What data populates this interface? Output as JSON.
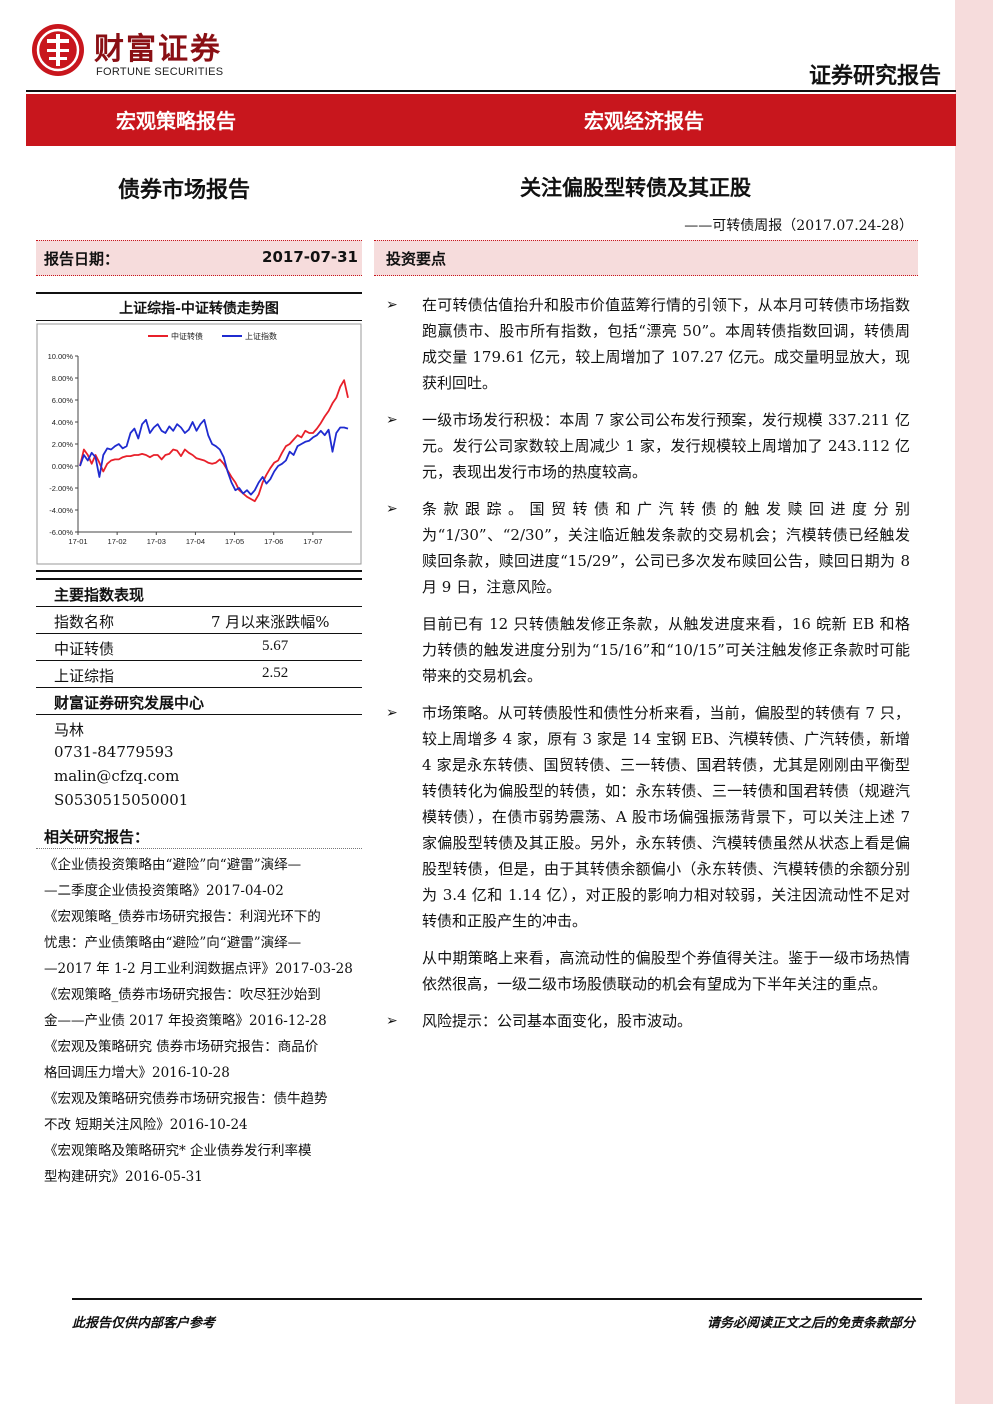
{
  "header": {
    "logo_cn": "财富证券",
    "logo_en": "FORTUNE SECURITIES",
    "doc_type": "证券研究报告"
  },
  "band": {
    "left": "宏观策略报告",
    "right": "宏观经济报告"
  },
  "titles": {
    "section": "债券市场报告",
    "main": "关注偏股型转债及其正股",
    "subtitle": "——可转债周报（2017.07.24-28）"
  },
  "report_date": {
    "label": "报告日期：",
    "value": "2017-07-31"
  },
  "investment_points_label": "投资要点",
  "chart_data": {
    "type": "line",
    "title": "上证综指-中证转债走势图",
    "legend": [
      "中证转债",
      "上证指数"
    ],
    "x_ticks": [
      "17-01",
      "17-02",
      "17-03",
      "17-04",
      "17-05",
      "17-06",
      "17-07"
    ],
    "y_ticks": [
      "10.00%",
      "8.00%",
      "6.00%",
      "4.00%",
      "2.00%",
      "0.00%",
      "-2.00%",
      "-4.00%",
      "-6.00%"
    ],
    "ylim": [
      -6,
      10
    ],
    "legend_position": "top",
    "colors": {
      "中证转债": "#e8202a",
      "上证指数": "#1f2bd0"
    },
    "series": [
      {
        "name": "中证转债",
        "values": [
          0.0,
          1.5,
          1.0,
          0.2,
          1.0,
          0.3,
          -0.5,
          0.2,
          0.5,
          0.6,
          0.6,
          0.8,
          0.9,
          0.9,
          1.0,
          1.0,
          1.1,
          1.0,
          0.8,
          1.0,
          1.0,
          0.6,
          1.0,
          1.1,
          1.5,
          1.4,
          0.9,
          1.5,
          1.2,
          1.0,
          0.7,
          0.6,
          0.5,
          0.3,
          0.2,
          0.3,
          0.6,
          0.2,
          -0.4,
          -1.0,
          -1.5,
          -2.2,
          -2.5,
          -2.8,
          -3.0,
          -3.2,
          -2.6,
          -1.5,
          -0.8,
          -0.2,
          0.3,
          0.5,
          1.2,
          1.8,
          2.0,
          2.4,
          2.8,
          2.6,
          3.2,
          3.0,
          3.0,
          3.4,
          3.9,
          4.5,
          5.0,
          5.7,
          6.2,
          7.2,
          7.8,
          6.2
        ]
      },
      {
        "name": "上证指数",
        "values": [
          0.0,
          1.0,
          0.5,
          1.2,
          0.8,
          -1.0,
          1.0,
          1.6,
          1.5,
          1.8,
          2.0,
          1.6,
          1.8,
          3.0,
          3.4,
          2.5,
          3.8,
          4.2,
          3.0,
          3.5,
          3.8,
          3.2,
          3.0,
          3.6,
          3.2,
          3.8,
          3.5,
          3.0,
          3.3,
          4.0,
          3.2,
          3.8,
          4.2,
          2.8,
          2.0,
          1.8,
          1.5,
          0.8,
          -0.5,
          -1.5,
          -2.2,
          -2.0,
          -2.5,
          -2.2,
          -2.6,
          -2.2,
          -1.5,
          -1.0,
          -1.6,
          -1.2,
          -0.5,
          0.0,
          0.2,
          0.5,
          1.3,
          1.0,
          1.8,
          2.0,
          2.2,
          2.3,
          2.6,
          2.8,
          3.2,
          2.8,
          3.3,
          1.3,
          3.0,
          3.5,
          3.5,
          3.4
        ]
      }
    ]
  },
  "index_table": {
    "title": "主要指数表现",
    "headers": [
      "指数名称",
      "7 月以来涨跌幅%"
    ],
    "rows": [
      [
        "中证转债",
        "5.67"
      ],
      [
        "上证综指",
        "2.52"
      ]
    ]
  },
  "research_center": {
    "title": "财富证券研究发展中心",
    "name": "马林",
    "phone": "0731-84779593",
    "email": "malin@cfzq.com",
    "cert": "S0530515050001"
  },
  "related": {
    "title": "相关研究报告：",
    "lines": [
      "《企业债投资策略由“避险”向“避雷”演绎—",
      "—二季度企业债投资策略》2017-04-02",
      "《宏观策略_债券市场研究报告：利润光环下的",
      "忧患：产业债策略由“避险”向“避雷”演绎—",
      "—2017 年 1-2 月工业利润数据点评》2017-03-28",
      "《宏观策略_债券市场研究报告：吹尽狂沙始到",
      "金——产业债 2017 年投资策略》2016-12-28",
      "《宏观及策略研究  债券市场研究报告：商品价",
      "格回调压力增大》2016-10-28",
      "《宏观及策略研究债券市场研究报告：债牛趋势",
      "不改  短期关注风险》2016-10-24",
      "《宏观策略及策略研究*  企业债券发行利率模",
      "型构建研究》2016-05-31"
    ]
  },
  "content": {
    "arrow": "➢",
    "b1": "在可转债估值抬升和股市价值蓝筹行情的引领下，从本月可转债市场指数跑赢债市、股市所有指数，包括“漂亮 50”。本周转债指数回调，转债周成交量 179.61 亿元，较上周增加了 107.27 亿元。成交量明显放大，现获利回吐。",
    "b2": "一级市场发行积极：本周 7 家公司公布发行预案，发行规模 337.211 亿元。发行公司家数较上周减少 1 家，发行规模较上周增加了 243.112 亿元，表现出发行市场的热度较高。",
    "b3": "条款跟踪。国贸转债和广汽转债的触发赎回进度分别为“1/30”、“2/30”，关注临近触发条款的交易机会；汽模转债已经触发赎回条款，赎回进度“15/29”，公司已多次发布赎回公告，赎回日期为 8 月 9 日，注意风险。",
    "p3": "目前已有 12 只转债触发修正条款，从触发进度来看，16 皖新 EB 和格力转债的触发进度分别为“15/16”和“10/15”可关注触发修正条款时可能带来的交易机会。",
    "b4": "市场策略。从可转债股性和债性分析来看，当前，偏股型的转债有 7 只，较上周增多 4 家，原有 3 家是 14 宝钢 EB、汽模转债、广汽转债，新增 4 家是永东转债、国贸转债、三一转债、国君转债，尤其是刚刚由平衡型转债转化为偏股型的转债，如：永东转债、三一转债和国君转债（规避汽模转债），在债市弱势震荡、A 股市场偏强振荡背景下，可以关注上述 7 家偏股型转债及其正股。另外，永东转债、汽模转债虽然从状态上看是偏股型转债，但是，由于其转债余额偏小（永东转债、汽模转债的余额分别为 3.4 亿和 1.14 亿），对正股的影响力相对较弱，关注因流动性不足对转债和正股产生的冲击。",
    "p4": "从中期策略上来看，高流动性的偏股型个券值得关注。鉴于一级市场热情依然很高，一级二级市场股债联动的机会有望成为下半年关注的重点。",
    "b5": "风险提示：公司基本面变化，股市波动。"
  },
  "footer": {
    "left": "此报告仅供内部客户参考",
    "right": "请务必阅读正文之后的免责条款部分"
  }
}
